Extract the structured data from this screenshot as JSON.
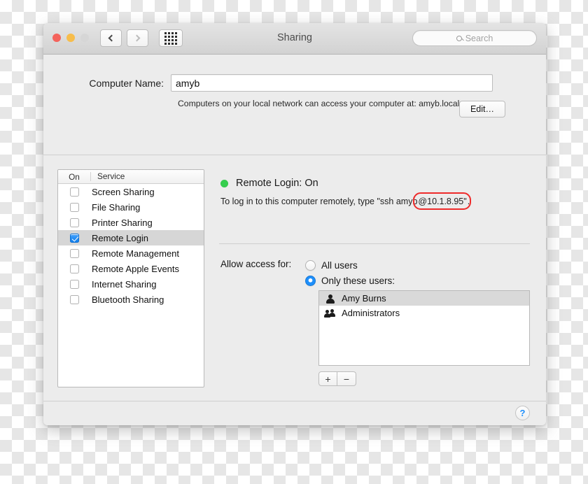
{
  "window": {
    "title": "Sharing",
    "traffic_lights": [
      "close",
      "minimize",
      "zoom"
    ],
    "nav": {
      "back_icon": "chevron-left-icon",
      "forward_icon": "chevron-right-icon",
      "show_all_icon": "grid-icon"
    },
    "search": {
      "placeholder": "Search",
      "value": "",
      "icon": "search-icon"
    }
  },
  "computer_name": {
    "label": "Computer Name:",
    "value": "amyb",
    "description": "Computers on your local network can access your computer at: amyb.local",
    "edit_button": "Edit…"
  },
  "services": {
    "columns": {
      "on": "On",
      "service": "Service"
    },
    "items": [
      {
        "name": "Screen Sharing",
        "enabled": false,
        "selected": false
      },
      {
        "name": "File Sharing",
        "enabled": false,
        "selected": false
      },
      {
        "name": "Printer Sharing",
        "enabled": false,
        "selected": false
      },
      {
        "name": "Remote Login",
        "enabled": true,
        "selected": true
      },
      {
        "name": "Remote Management",
        "enabled": false,
        "selected": false
      },
      {
        "name": "Remote Apple Events",
        "enabled": false,
        "selected": false
      },
      {
        "name": "Internet Sharing",
        "enabled": false,
        "selected": false
      },
      {
        "name": "Bluetooth Sharing",
        "enabled": false,
        "selected": false
      }
    ]
  },
  "detail": {
    "status_title": "Remote Login: On",
    "status_color": "#36ce4e",
    "instructions_prefix": "To log in to this computer remotely, type \"ssh amyb",
    "instructions_highlight": "@10.1.8.95\"",
    "instructions_suffix": ".",
    "annotation_color": "#ee2b2b",
    "allow_access_label": "Allow access for:",
    "radios": [
      {
        "label": "All users",
        "selected": false
      },
      {
        "label": "Only these users:",
        "selected": true
      }
    ],
    "users": [
      {
        "name": "Amy Burns",
        "icon": "user-icon",
        "selected": true
      },
      {
        "name": "Administrators",
        "icon": "group-icon",
        "selected": false
      }
    ],
    "add_button": "+",
    "remove_button": "−"
  },
  "help_button": "?"
}
